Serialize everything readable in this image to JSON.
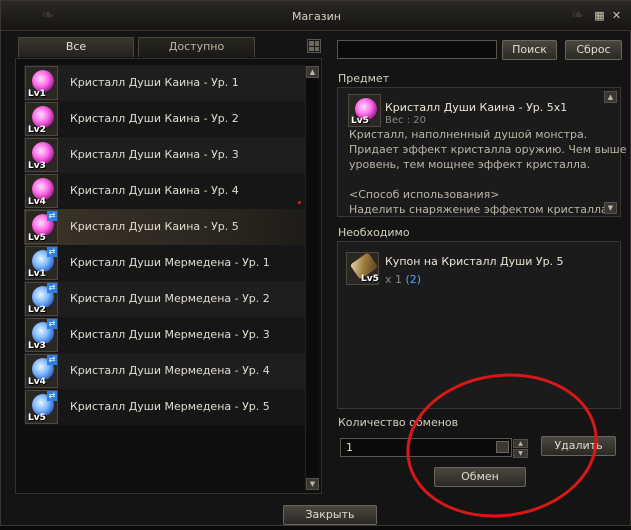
{
  "window": {
    "title": "Магазин"
  },
  "tabs": [
    {
      "label": "Все",
      "active": true
    },
    {
      "label": "Доступно",
      "active": false
    }
  ],
  "list": {
    "items": [
      {
        "label": "Кристалл Души Каина - Ур. 1",
        "lv": "Lv1",
        "color": "pink",
        "swap": false,
        "selected": false
      },
      {
        "label": "Кристалл Души Каина - Ур. 2",
        "lv": "Lv2",
        "color": "pink",
        "swap": false,
        "selected": false
      },
      {
        "label": "Кристалл Души Каина - Ур. 3",
        "lv": "Lv3",
        "color": "pink",
        "swap": false,
        "selected": false
      },
      {
        "label": "Кристалл Души Каина - Ур. 4",
        "lv": "Lv4",
        "color": "pink",
        "swap": false,
        "selected": false
      },
      {
        "label": "Кристалл Души Каина - Ур. 5",
        "lv": "Lv5",
        "color": "pink",
        "swap": true,
        "selected": true
      },
      {
        "label": "Кристалл Души Мермедена - Ур. 1",
        "lv": "Lv1",
        "color": "blue",
        "swap": true,
        "selected": false
      },
      {
        "label": "Кристалл Души Мермедена - Ур. 2",
        "lv": "Lv2",
        "color": "blue",
        "swap": true,
        "selected": false
      },
      {
        "label": "Кристалл Души Мермедена - Ур. 3",
        "lv": "Lv3",
        "color": "blue",
        "swap": true,
        "selected": false
      },
      {
        "label": "Кристалл Души Мермедена - Ур. 4",
        "lv": "Lv4",
        "color": "blue",
        "swap": true,
        "selected": false
      },
      {
        "label": "Кристалл Души Мермедена - Ур. 5",
        "lv": "Lv5",
        "color": "blue",
        "swap": true,
        "selected": false
      }
    ]
  },
  "search": {
    "value": "",
    "search_label": "Поиск",
    "reset_label": "Сброс"
  },
  "item": {
    "section_label": "Предмет",
    "title": "Кристалл Души Каина - Ур. 5x1",
    "lv": "Lv5",
    "weight": "Вес : 20",
    "description": [
      "Кристалл, наполненный душой монстра.",
      "Придает эффект кристалла оружию. Чем выше",
      "уровень, тем мощнее эффект кристалла.",
      "",
      "<Способ использования>",
      "Наделить снаряжение эффектом кристалла"
    ]
  },
  "required": {
    "section_label": "Необходимо",
    "name": "Купон на Кристалл Души Ур. 5",
    "lv": "Lv5",
    "qty": "x 1",
    "owned": "(2)"
  },
  "exchange": {
    "qty_label": "Количество обменов",
    "qty_value": "1",
    "delete_label": "Удалить",
    "exchange_label": "Обмен"
  },
  "footer": {
    "close_label": "Закрыть"
  },
  "colors": {
    "accent_red": "#d81818",
    "owned_blue": "#5aa0ff"
  }
}
